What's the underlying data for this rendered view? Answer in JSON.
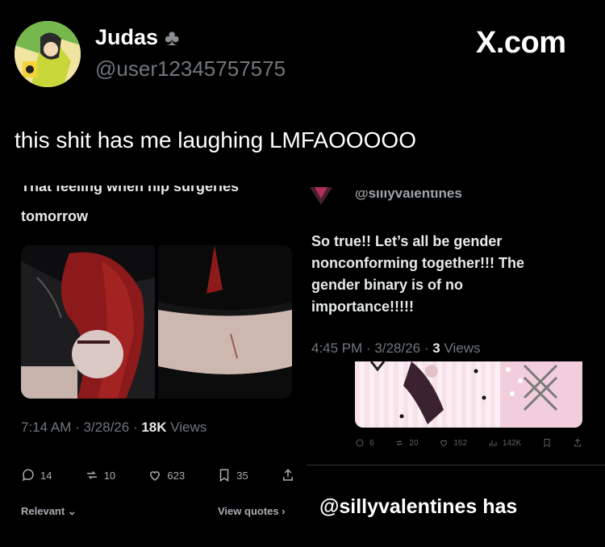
{
  "header": {
    "display_name": "Judas",
    "name_emoji": "♣",
    "handle": "@user12345757575",
    "brand": "X.com"
  },
  "caption": "this shit has me laughing LMFAOOOOO",
  "left_post": {
    "text_line1_cut": "That feeling when hip surgeries",
    "text_line2": "tomorrow",
    "time": "7:14 AM",
    "date": "3/28/26",
    "views": "18K",
    "views_label": "Views",
    "replies": "14",
    "reposts": "10",
    "likes": "623",
    "bookmarks": "35",
    "relevant": "Relevant",
    "view_quotes": "View quotes"
  },
  "right_post": {
    "handle_cut": "@sillyvalentines",
    "body": "So true!! Let’s all be gender nonconforming together!!! The gender binary is of no importance!!!!!",
    "time": "4:45 PM",
    "date": "3/28/26",
    "views": "3",
    "views_label": "Views",
    "replies": "6",
    "reposts": "20",
    "likes": "162",
    "view_count": "142K",
    "footer": "@sillyvalentines has"
  }
}
